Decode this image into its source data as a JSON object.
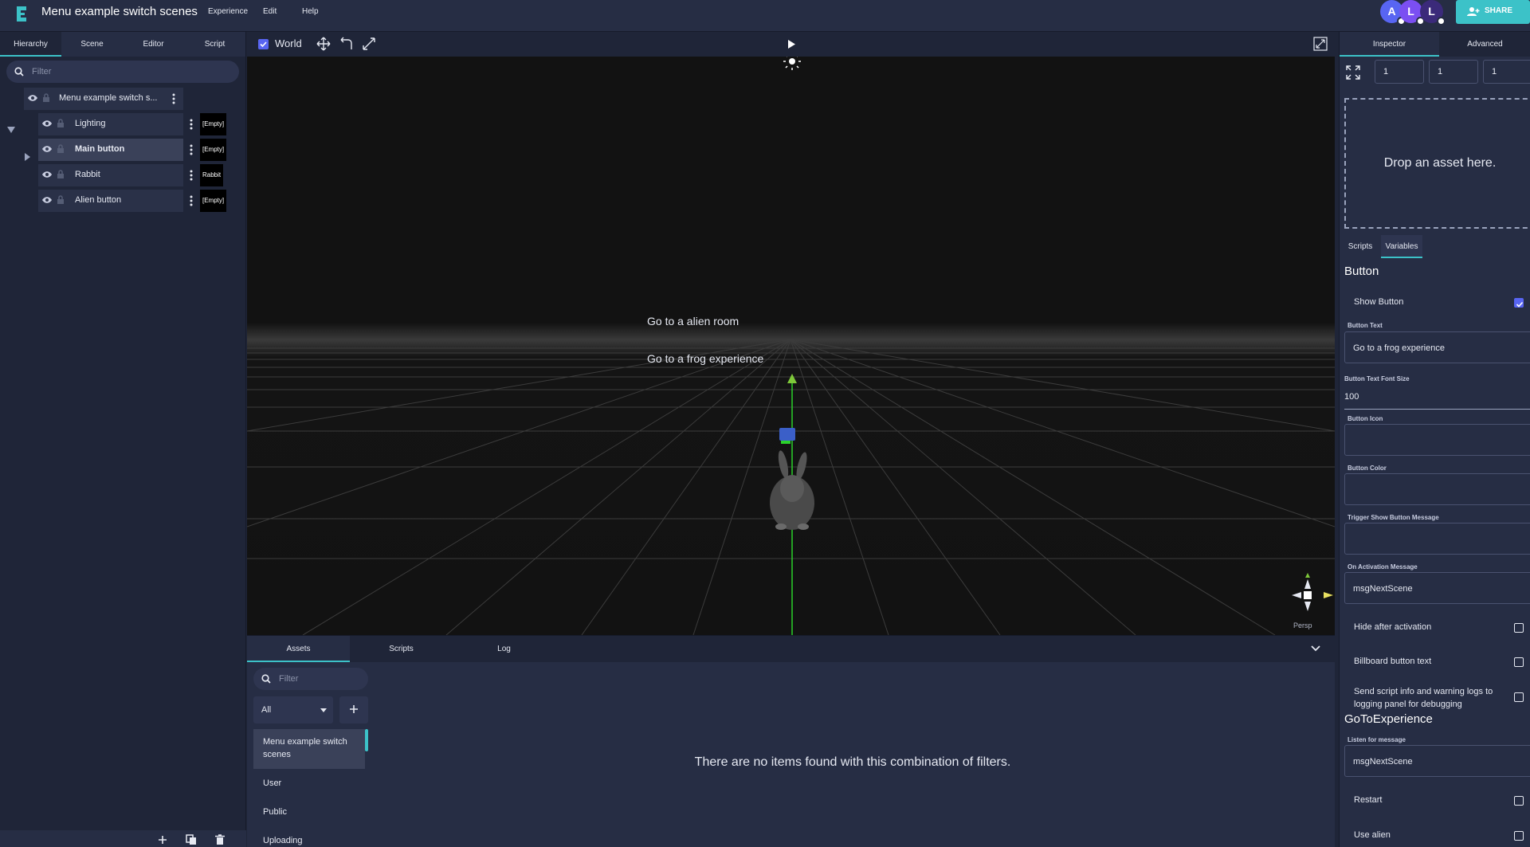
{
  "app": {
    "title": "Menu example switch scenes",
    "menu": [
      "Experience",
      "Edit",
      "Help"
    ],
    "avatars": [
      {
        "letter": "A",
        "color": "#5865f2"
      },
      {
        "letter": "L",
        "color": "#7b4ff2"
      },
      {
        "letter": "L",
        "color": "#3b2a7a"
      }
    ],
    "share_label": "SHARE"
  },
  "left_panel": {
    "tabs": [
      "Hierarchy",
      "Scene",
      "Editor",
      "Script"
    ],
    "active_tab": "Hierarchy",
    "filter_placeholder": "Filter",
    "root": {
      "label": "Menu example switch s..."
    },
    "items": [
      {
        "label": "Lighting",
        "tag": "[Empty]",
        "expandable": true,
        "selected": false
      },
      {
        "label": "Main button",
        "tag": "[Empty]",
        "expandable": false,
        "selected": true
      },
      {
        "label": "Rabbit",
        "tag": "Rabbit",
        "expandable": false,
        "selected": false
      },
      {
        "label": "Alien button",
        "tag": "[Empty]",
        "expandable": false,
        "selected": false
      }
    ]
  },
  "viewport": {
    "world_label": "World",
    "world_checked": true,
    "scene_labels": [
      "Go to a alien room",
      "Go to a frog experience"
    ],
    "camera_mode": "Persp"
  },
  "bottom_panel": {
    "tabs": [
      "Assets",
      "Scripts",
      "Log"
    ],
    "active_tab": "Assets",
    "filter_placeholder": "Filter",
    "select_value": "All",
    "asset_categories": [
      "Menu example switch scenes",
      "User",
      "Public",
      "Uploading"
    ],
    "active_category": "Menu example switch scenes",
    "empty_message": "There are no items found with this combination of filters."
  },
  "inspector": {
    "tabs": [
      "Inspector",
      "Advanced"
    ],
    "active_tab": "Inspector",
    "scale": [
      "1",
      "1",
      "1"
    ],
    "drop_zone_text": "Drop an asset here.",
    "sub_tabs": [
      "Scripts",
      "Variables"
    ],
    "active_sub_tab": "Variables",
    "button_section": {
      "title": "Button",
      "show_button_label": "Show Button",
      "show_button_checked": true,
      "button_text_label": "Button Text",
      "button_text_value": "Go to a frog experience",
      "font_size_label": "Button Text Font Size",
      "font_size_value": "100",
      "icon_label": "Button Icon",
      "color_label": "Button Color",
      "trigger_label": "Trigger Show Button Message",
      "activation_label": "On Activation Message",
      "activation_value": "msgNextScene",
      "hide_after_label": "Hide after activation",
      "billboard_label": "Billboard button text",
      "send_logs_label": "Send script info and warning logs to logging panel for debugging"
    },
    "goto_section": {
      "title": "GoToExperience",
      "listen_label": "Listen for message",
      "listen_value": "msgNextScene",
      "restart_label": "Restart",
      "use_alien_label": "Use alien"
    }
  },
  "colors": {
    "accent": "#3cc2c8",
    "check": "#5865f2",
    "background": "#1f2538",
    "panel": "#262d44"
  }
}
